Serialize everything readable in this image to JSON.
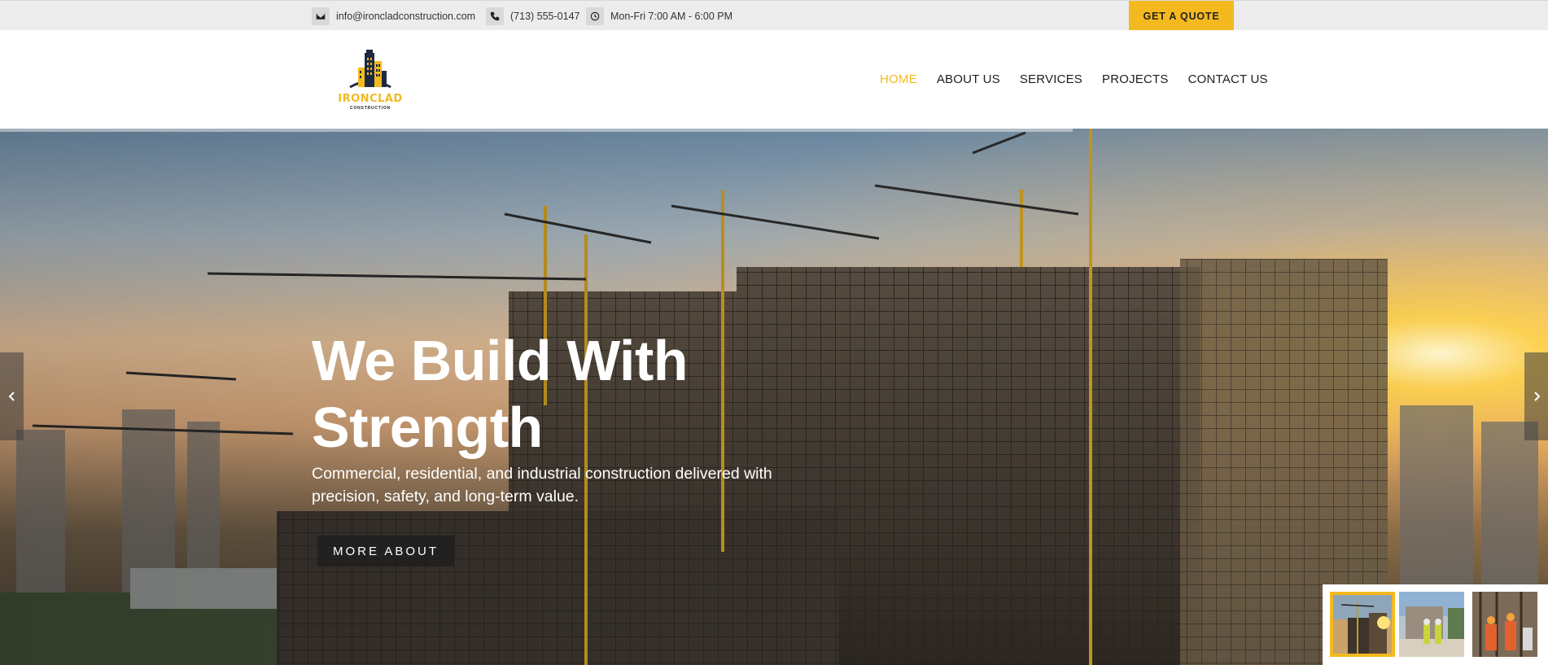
{
  "topbar": {
    "email": "info@ironcladconstruction.com",
    "phone": "(713) 555-0147",
    "hours": "Mon-Fri 7:00 AM - 6:00 PM",
    "quote_label": "GET A QUOTE",
    "icons": [
      "envelope-icon",
      "phone-icon",
      "clock-icon"
    ]
  },
  "header": {
    "logo_name": "IRONCLAD",
    "logo_sub": "CONSTRUCTION",
    "nav": [
      {
        "label": "HOME",
        "active": true
      },
      {
        "label": "ABOUT US",
        "active": false
      },
      {
        "label": "SERVICES",
        "active": false
      },
      {
        "label": "PROJECTS",
        "active": false
      },
      {
        "label": "CONTACT US",
        "active": false
      }
    ]
  },
  "hero": {
    "title_line1": "We Build With",
    "title_line2": "Strength",
    "subtitle_line1": "Commercial, residential, and industrial construction delivered with",
    "subtitle_line2": "precision, safety, and long-term value.",
    "button_label": "MORE ABOUT",
    "slide_count": 3,
    "active_slide": 1
  },
  "colors": {
    "accent": "#f3b91f",
    "topbar_bg": "#ececec",
    "text_dark": "#1e1e1e",
    "hero_text": "#ffffff"
  }
}
